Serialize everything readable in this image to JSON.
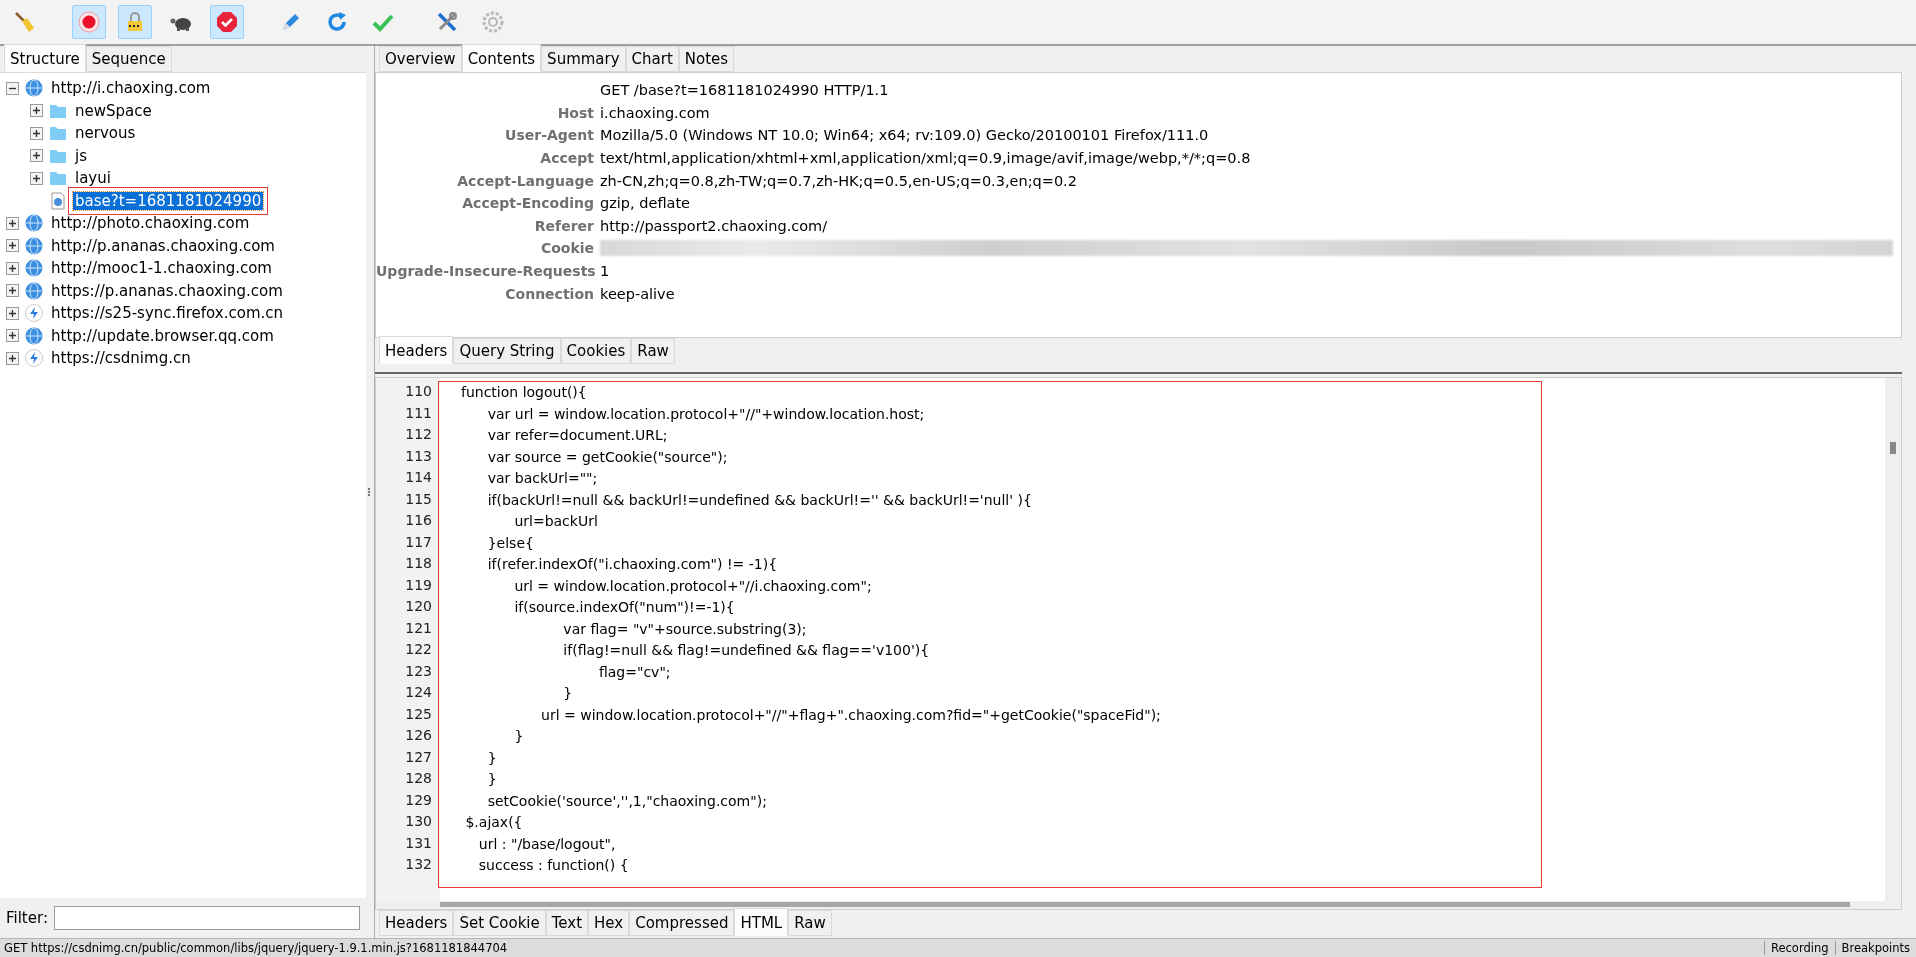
{
  "toolbar": [
    {
      "kind": "broom",
      "pressed": false
    },
    {
      "kind": "record",
      "pressed": true
    },
    {
      "kind": "lock",
      "pressed": true
    },
    {
      "kind": "turtle",
      "pressed": false
    },
    {
      "kind": "stop",
      "pressed": true
    },
    {
      "kind": "pen",
      "pressed": false
    },
    {
      "kind": "refresh",
      "pressed": false
    },
    {
      "kind": "check",
      "pressed": false
    },
    {
      "kind": "tools",
      "pressed": false
    },
    {
      "kind": "gear",
      "pressed": false
    }
  ],
  "left_tabs": [
    {
      "label": "Structure",
      "selected": true
    },
    {
      "label": "Sequence",
      "selected": false
    }
  ],
  "tree": [
    {
      "label": "http://i.chaoxing.com",
      "kind": "site",
      "expanded": true,
      "selected": false,
      "children": [
        {
          "label": "newSpace",
          "kind": "folder",
          "expanded": false,
          "selected": false
        },
        {
          "label": "nervous",
          "kind": "folder",
          "expanded": false,
          "selected": false
        },
        {
          "label": "js",
          "kind": "folder",
          "expanded": false,
          "selected": false
        },
        {
          "label": "layui",
          "kind": "folder",
          "expanded": false,
          "selected": false
        },
        {
          "label": "base?t=1681181024990",
          "kind": "file",
          "selected": true
        }
      ]
    },
    {
      "label": "http://photo.chaoxing.com",
      "kind": "site",
      "expanded": false,
      "selected": false
    },
    {
      "label": "http://p.ananas.chaoxing.com",
      "kind": "site",
      "expanded": false,
      "selected": false
    },
    {
      "label": "http://mooc1-1.chaoxing.com",
      "kind": "site",
      "expanded": false,
      "selected": false
    },
    {
      "label": "https://p.ananas.chaoxing.com",
      "kind": "site",
      "expanded": false,
      "selected": false
    },
    {
      "label": "https://s25-sync.firefox.com.cn",
      "kind": "bolt",
      "expanded": false,
      "selected": false
    },
    {
      "label": "http://update.browser.qq.com",
      "kind": "site",
      "expanded": false,
      "selected": false
    },
    {
      "label": "https://csdnimg.cn",
      "kind": "bolt",
      "expanded": false,
      "selected": false
    }
  ],
  "filter": {
    "label": "Filter:"
  },
  "view_tabs": [
    {
      "label": "Overview",
      "selected": false
    },
    {
      "label": "Contents",
      "selected": true
    },
    {
      "label": "Summary",
      "selected": false
    },
    {
      "label": "Chart",
      "selected": false
    },
    {
      "label": "Notes",
      "selected": false
    }
  ],
  "request_headers": [
    {
      "kind": "request_line",
      "value": "GET /base?t=1681181024990 HTTP/1.1"
    },
    {
      "kind": "header",
      "name": "Host",
      "value": "i.chaoxing.com"
    },
    {
      "kind": "header",
      "name": "User-Agent",
      "value": "Mozilla/5.0 (Windows NT 10.0; Win64; x64; rv:109.0) Gecko/20100101 Firefox/111.0"
    },
    {
      "kind": "header",
      "name": "Accept",
      "value": "text/html,application/xhtml+xml,application/xml;q=0.9,image/avif,image/webp,*/*;q=0.8"
    },
    {
      "kind": "header",
      "name": "Accept-Language",
      "value": "zh-CN,zh;q=0.8,zh-TW;q=0.7,zh-HK;q=0.5,en-US;q=0.3,en;q=0.2"
    },
    {
      "kind": "header",
      "name": "Accept-Encoding",
      "value": "gzip, deflate"
    },
    {
      "kind": "header",
      "name": "Referer",
      "value": "http://passport2.chaoxing.com/"
    },
    {
      "kind": "redacted",
      "name": "Cookie"
    },
    {
      "kind": "header",
      "name": "Upgrade-Insecure-Requests",
      "value": "1"
    },
    {
      "kind": "header",
      "name": "Connection",
      "value": "keep-alive"
    }
  ],
  "request_tabs": [
    {
      "label": "Headers",
      "selected": true
    },
    {
      "label": "Query String",
      "selected": false
    },
    {
      "label": "Cookies",
      "selected": false
    },
    {
      "label": "Raw",
      "selected": false
    }
  ],
  "code": [
    {
      "number": "110",
      "text": "function logout(){"
    },
    {
      "number": "111",
      "text": "      var url = window.location.protocol+\"//\"+window.location.host;"
    },
    {
      "number": "112",
      "text": "      var refer=document.URL;"
    },
    {
      "number": "113",
      "text": "      var source = getCookie(\"source\");"
    },
    {
      "number": "114",
      "text": "      var backUrl=\"\";"
    },
    {
      "number": "115",
      "text": "      if(backUrl!=null && backUrl!=undefined && backUrl!='' && backUrl!='null' ){"
    },
    {
      "number": "116",
      "text": "            url=backUrl"
    },
    {
      "number": "117",
      "text": "      }else{"
    },
    {
      "number": "118",
      "text": "      if(refer.indexOf(\"i.chaoxing.com\") != -1){"
    },
    {
      "number": "119",
      "text": "            url = window.location.protocol+\"//i.chaoxing.com\";"
    },
    {
      "number": "120",
      "text": "            if(source.indexOf(\"num\")!=-1){"
    },
    {
      "number": "121",
      "text": "                       var flag= \"v\"+source.substring(3);"
    },
    {
      "number": "122",
      "text": "                       if(flag!=null && flag!=undefined && flag=='v100'){"
    },
    {
      "number": "123",
      "text": "                               flag=\"cv\";"
    },
    {
      "number": "124",
      "text": "                       }"
    },
    {
      "number": "125",
      "text": "                  url = window.location.protocol+\"//\"+flag+\".chaoxing.com?fid=\"+getCookie(\"spaceFid\");"
    },
    {
      "number": "126",
      "text": "            }"
    },
    {
      "number": "127",
      "text": "      }"
    },
    {
      "number": "128",
      "text": "      }"
    },
    {
      "number": "129",
      "text": "      setCookie('source','',1,\"chaoxing.com\");"
    },
    {
      "number": "130",
      "text": " $.ajax({"
    },
    {
      "number": "131",
      "text": "    url : \"/base/logout\","
    },
    {
      "number": "132",
      "text": "    success : function() {"
    }
  ],
  "response_tabs": [
    {
      "label": "Headers",
      "selected": false
    },
    {
      "label": "Set Cookie",
      "selected": false
    },
    {
      "label": "Text",
      "selected": false
    },
    {
      "label": "Hex",
      "selected": false
    },
    {
      "label": "Compressed",
      "selected": false
    },
    {
      "label": "HTML",
      "selected": true
    },
    {
      "label": "Raw",
      "selected": false
    }
  ],
  "status_bar": {
    "text": "GET https://csdnimg.cn/public/common/libs/jquery/jquery-1.9.1.min.js?1681181844704",
    "panels": [
      "Recording",
      "Breakpoints"
    ]
  }
}
